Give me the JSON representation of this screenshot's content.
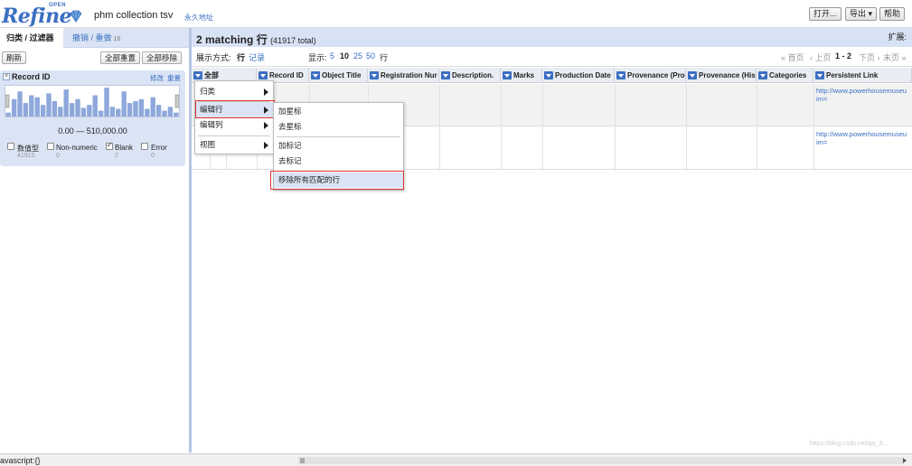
{
  "header": {
    "logo_word": "Refine",
    "logo_open": "OPEN",
    "project_name": "phm collection tsv",
    "permalink": "永久地址",
    "buttons": {
      "open": "打开...",
      "export": "导出 ▾",
      "help": "帮助"
    }
  },
  "left_panel": {
    "tabs": {
      "facets": "归类 / 过滤器",
      "undo": "撤销 / 重做",
      "undo_count": "16"
    },
    "toolbar": {
      "refresh": "刷新",
      "reset_all": "全部重置",
      "remove_all": "全部移除"
    },
    "facet": {
      "title": "Record ID",
      "change": "修改",
      "reset": "重置",
      "close": "×",
      "range": "0.00 — 510,000.00",
      "histogram": [
        4,
        18,
        26,
        14,
        22,
        20,
        12,
        24,
        16,
        10,
        28,
        14,
        18,
        9,
        12,
        22,
        6,
        30,
        10,
        8,
        26,
        14,
        16,
        18,
        8,
        20,
        12,
        6,
        10,
        4
      ],
      "choices": [
        {
          "label": "数值型",
          "count": "41915",
          "checked": false
        },
        {
          "label": "Non-numeric",
          "count": "0",
          "checked": false
        },
        {
          "label": "Blank",
          "count": "2",
          "checked": true
        },
        {
          "label": "Error",
          "count": "0",
          "checked": false
        }
      ]
    }
  },
  "summary": {
    "matching": "2 matching",
    "rows_word": "行",
    "total": "(41917 total)",
    "extensions": "扩展:"
  },
  "view_bar": {
    "show_as": "展示方式:",
    "rows": "行",
    "records": "记录",
    "show": "显示:",
    "page_sizes": [
      "5",
      "10",
      "25",
      "50"
    ],
    "page_size_active": "10",
    "rows_suffix": "行",
    "first": "« 首页",
    "prev": "‹ 上页",
    "range": "1 - 2",
    "next": "下页 ›",
    "last": "末页 »"
  },
  "columns": [
    "全部",
    "Record ID",
    "Object Title",
    "Registration Nur",
    "Description.",
    "Marks",
    "Production Date",
    "Provenance (Pro",
    "Provenance (His",
    "Categories",
    "Persistent Link"
  ],
  "rows": [
    {
      "link_1": "http://www.powerhousemuseu",
      "link_2": "im="
    },
    {
      "link_1": "http://www.powerhousemuseu",
      "link_2": "im="
    }
  ],
  "menu_main": {
    "items": [
      "归类",
      "编辑行",
      "编辑列",
      "视图"
    ]
  },
  "menu_sub": {
    "items": [
      "加星标",
      "去星标",
      "加标记",
      "去标记",
      "移除所有匹配的行"
    ]
  },
  "status": {
    "text": "avascript:{}"
  },
  "watermark": "https://blog.csdn.net/qq_3..."
}
